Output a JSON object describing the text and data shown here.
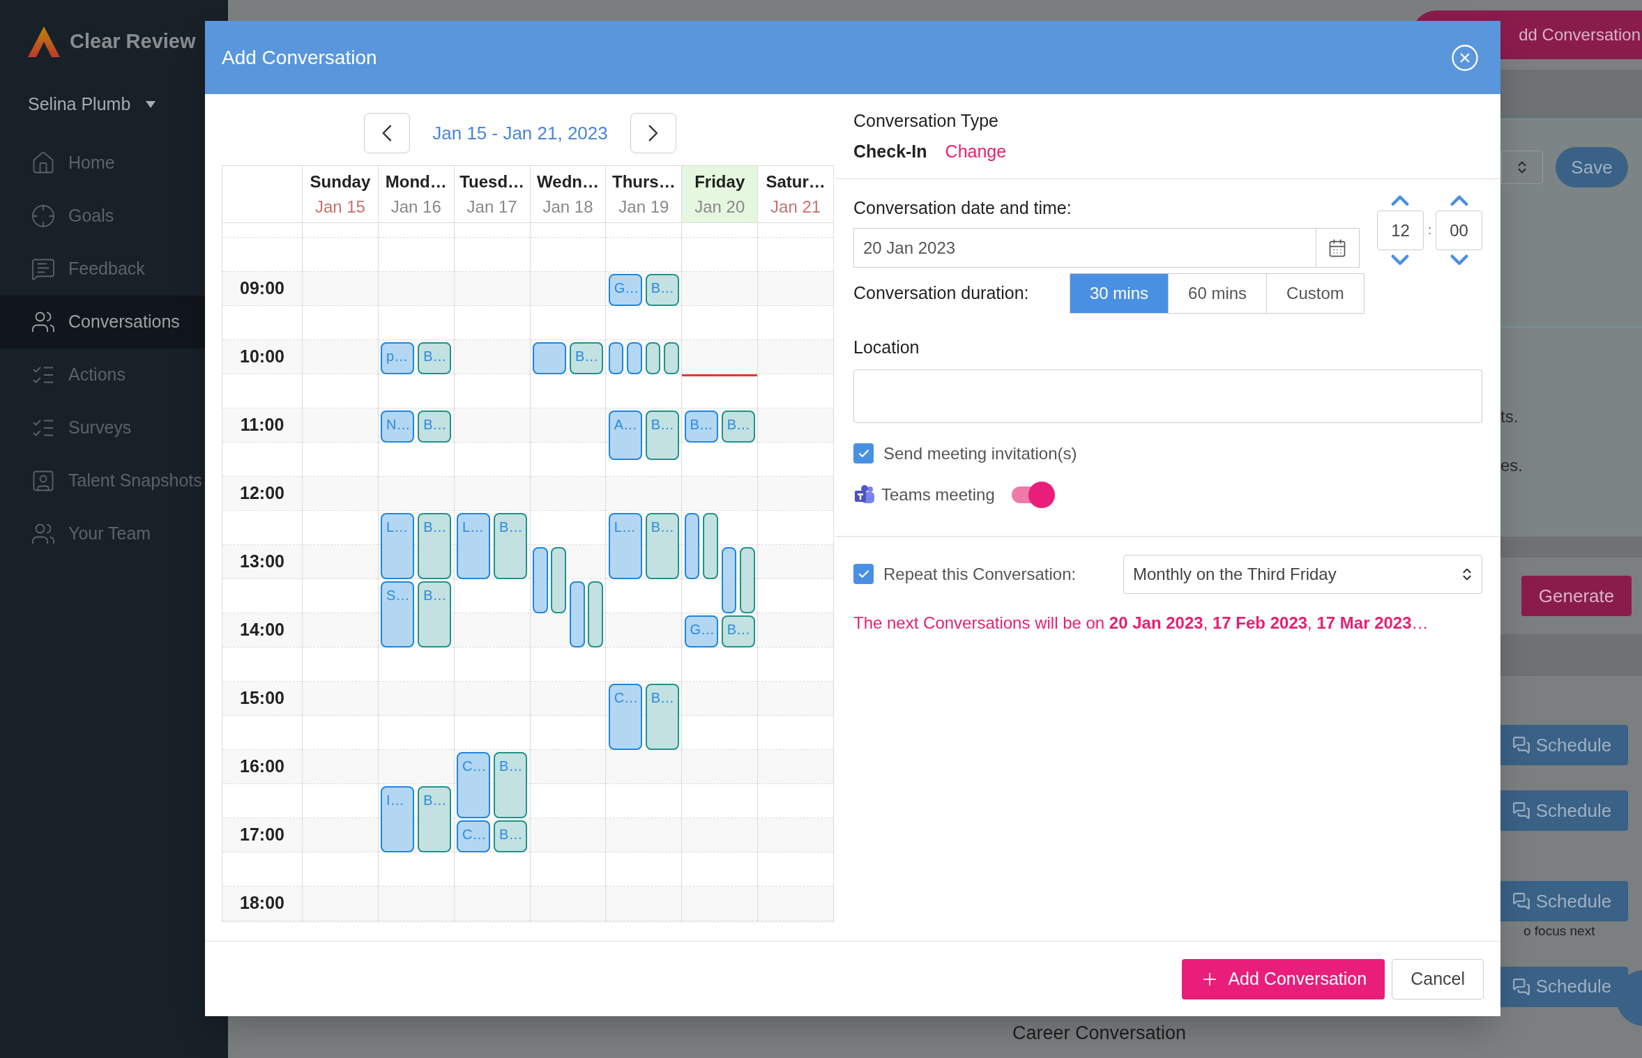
{
  "sidebar": {
    "brand": "Clear Review",
    "user": "Selina Plumb",
    "items": [
      {
        "label": "Home",
        "selected": false
      },
      {
        "label": "Goals",
        "selected": false
      },
      {
        "label": "Feedback",
        "selected": false
      },
      {
        "label": "Conversations",
        "selected": true
      },
      {
        "label": "Actions",
        "selected": false
      },
      {
        "label": "Surveys",
        "selected": false
      },
      {
        "label": "Talent Snapshots",
        "selected": false
      },
      {
        "label": "Your Team",
        "selected": false
      }
    ]
  },
  "background": {
    "top_button": "dd Conversation",
    "save_button": "Save",
    "fragments": [
      "ts.",
      "es."
    ],
    "generate_button": "Generate",
    "schedule_buttons": [
      "Schedule",
      "Schedule",
      "Schedule",
      "Schedule"
    ],
    "hint": "o focus next",
    "section_title": "Career Conversation"
  },
  "modal": {
    "title": "Add Conversation",
    "calendar": {
      "range": "Jan 15 - Jan 21, 2023",
      "times": [
        "09:00",
        "10:00",
        "11:00",
        "12:00",
        "13:00",
        "14:00",
        "15:00",
        "16:00",
        "17:00",
        "18:00"
      ],
      "days": [
        {
          "name": "Sunday",
          "date": "Jan 15",
          "weekend": true,
          "today": false
        },
        {
          "name": "Mond…",
          "date": "Jan 16",
          "weekend": false,
          "today": false,
          "events": [
            {
              "label": "p…",
              "kind": "person"
            },
            {
              "label": "B…",
              "kind": "booking"
            },
            {
              "label": "N…",
              "kind": "person"
            },
            {
              "label": "B…",
              "kind": "booking"
            },
            {
              "label": "L…",
              "kind": "person"
            },
            {
              "label": "B…",
              "kind": "booking"
            },
            {
              "label": "S…",
              "kind": "person"
            },
            {
              "label": "B…",
              "kind": "booking"
            },
            {
              "label": "I…",
              "kind": "person"
            },
            {
              "label": "B…",
              "kind": "booking"
            }
          ]
        },
        {
          "name": "Tuesd…",
          "date": "Jan 17",
          "weekend": false,
          "today": false,
          "events": [
            {
              "label": "L…",
              "kind": "person"
            },
            {
              "label": "B…",
              "kind": "booking"
            },
            {
              "label": "C…",
              "kind": "person"
            },
            {
              "label": "B…",
              "kind": "booking"
            },
            {
              "label": "C…",
              "kind": "person"
            },
            {
              "label": "B…",
              "kind": "booking"
            }
          ]
        },
        {
          "name": "Wedn…",
          "date": "Jan 18",
          "weekend": false,
          "today": false,
          "events": [
            {
              "kind": "person"
            },
            {
              "label": "B…",
              "kind": "booking"
            },
            {
              "kind": "person"
            },
            {
              "kind": "booking"
            },
            {
              "kind": "person"
            },
            {
              "kind": "booking"
            }
          ]
        },
        {
          "name": "Thurs…",
          "date": "Jan 19",
          "weekend": false,
          "today": false,
          "events": [
            {
              "label": "G…",
              "kind": "person"
            },
            {
              "label": "B…",
              "kind": "booking"
            },
            {
              "kind": "person"
            },
            {
              "kind": "person"
            },
            {
              "kind": "booking"
            },
            {
              "kind": "booking"
            },
            {
              "label": "A…",
              "kind": "person"
            },
            {
              "label": "B…",
              "kind": "booking"
            },
            {
              "label": "L…",
              "kind": "person"
            },
            {
              "label": "B…",
              "kind": "booking"
            },
            {
              "label": "C…",
              "kind": "person"
            },
            {
              "label": "B…",
              "kind": "booking"
            }
          ]
        },
        {
          "name": "Friday",
          "date": "Jan 20",
          "weekend": false,
          "today": true,
          "events": [
            {
              "label": "B…",
              "kind": "person"
            },
            {
              "label": "B…",
              "kind": "booking"
            },
            {
              "kind": "person"
            },
            {
              "kind": "booking"
            },
            {
              "kind": "person"
            },
            {
              "kind": "booking"
            },
            {
              "label": "G…",
              "kind": "person"
            },
            {
              "label": "B…",
              "kind": "booking"
            }
          ]
        },
        {
          "name": "Satur…",
          "date": "Jan 21",
          "weekend": true,
          "today": false
        }
      ]
    },
    "form": {
      "type_label": "Conversation Type",
      "type_value": "Check-In",
      "change_link": "Change",
      "date_label": "Conversation date and time:",
      "date_value": "20 Jan 2023",
      "hour": "12",
      "minute": "00",
      "separator": ":",
      "duration_label": "Conversation duration:",
      "durations": [
        {
          "label": "30 mins",
          "selected": true
        },
        {
          "label": "60 mins",
          "selected": false
        },
        {
          "label": "Custom",
          "selected": false
        }
      ],
      "location_label": "Location",
      "send_invitation": {
        "label": "Send meeting invitation(s)",
        "checked": true
      },
      "teams_meeting": {
        "label": "Teams meeting",
        "on": true
      },
      "repeat": {
        "label": "Repeat this Conversation:",
        "checked": true,
        "value": "Monthly on the Third Friday"
      },
      "next_text": "The next Conversations will be on **20 Jan 2023**, **17 Feb 2023**, **17 Mar 2023**…"
    },
    "buttons": {
      "add": "Add Conversation",
      "cancel": "Cancel"
    }
  }
}
